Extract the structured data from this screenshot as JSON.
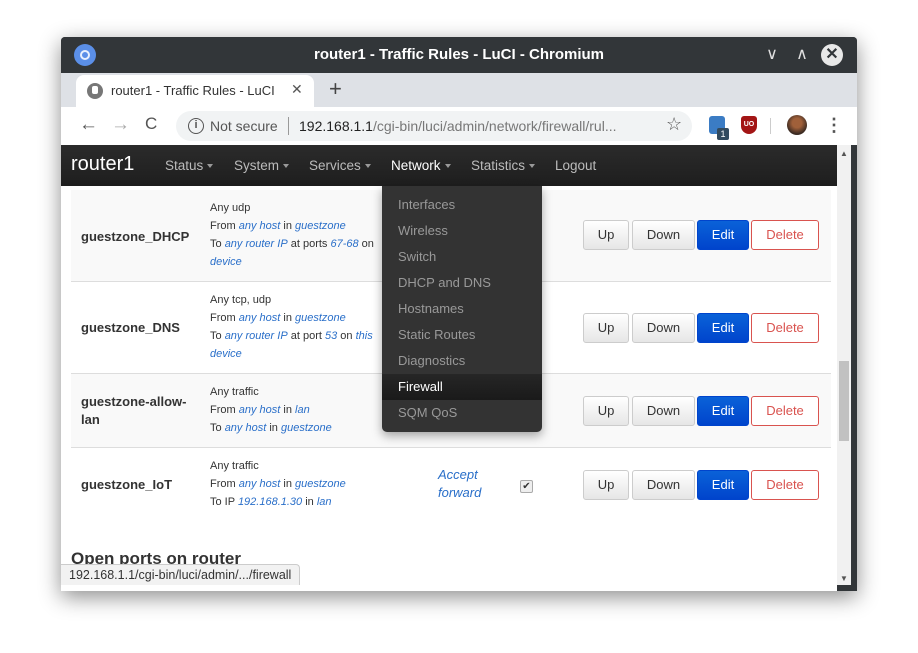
{
  "window": {
    "title": "router1 - Traffic Rules - LuCI - Chromium",
    "controls": {
      "minimize": "∨",
      "maximize": "∧",
      "close": "✕"
    }
  },
  "tab": {
    "title": "router1 - Traffic Rules - LuCI",
    "close": "✕",
    "new_tab": "+"
  },
  "toolbar": {
    "back": "←",
    "forward": "→",
    "reload": "C",
    "security_label": "Not secure",
    "url_host": "192.168.1.1",
    "url_path": "/cgi-bin/luci/admin/network/firewall/rul...",
    "bookmark": "☆",
    "extension_badge": "1",
    "extension2_label": "UO",
    "menu": "⋮"
  },
  "navbar": {
    "brand": "router1",
    "items": [
      {
        "label": "Status",
        "dropdown": true
      },
      {
        "label": "System",
        "dropdown": true
      },
      {
        "label": "Services",
        "dropdown": true
      },
      {
        "label": "Network",
        "dropdown": true
      },
      {
        "label": "Statistics",
        "dropdown": true
      },
      {
        "label": "Logout",
        "dropdown": false
      }
    ]
  },
  "network_menu": {
    "items": [
      "Interfaces",
      "Wireless",
      "Switch",
      "DHCP and DNS",
      "Hostnames",
      "Static Routes",
      "Diagnostics",
      "Firewall",
      "SQM QoS"
    ],
    "active": "Firewall"
  },
  "rules": [
    {
      "name": "guestzone_DHCP",
      "line1": "Any udp",
      "from_pre": "From ",
      "from_host": "any host",
      "from_mid": " in ",
      "from_zone": "guestzone",
      "to_pre": "To ",
      "to_host": "any router IP",
      "to_mid": " at ports ",
      "to_port": "67-68",
      "to_post": " on ",
      "to_device": "device"
    },
    {
      "name": "guestzone_DNS",
      "line1": "Any tcp, udp",
      "from_pre": "From ",
      "from_host": "any host",
      "from_mid": " in ",
      "from_zone": "guestzone",
      "to_pre": "To ",
      "to_host": "any router IP",
      "to_mid": " at port ",
      "to_port": "53",
      "to_post": " on ",
      "to_this": "this",
      "to_device": "device"
    },
    {
      "name": "guestzone-allow-lan",
      "line1": "Any traffic",
      "from_pre": "From ",
      "from_host": "any host",
      "from_mid": " in ",
      "from_zone": "lan",
      "to_pre": "To ",
      "to_host": "any host",
      "to_mid": " in ",
      "to_zone": "guestzone"
    },
    {
      "name": "guestzone_IoT",
      "line1": "Any traffic",
      "from_pre": "From ",
      "from_host": "any host",
      "from_mid": " in ",
      "from_zone": "guestzone",
      "to_pre": "To IP ",
      "to_ip": "192.168.1.30",
      "to_mid": " in ",
      "to_zone": "lan",
      "action": "Accept forward",
      "enabled": true
    }
  ],
  "buttons": {
    "up": "Up",
    "down": "Down",
    "edit": "Edit",
    "delete": "Delete"
  },
  "section_title": "Open ports on router",
  "status_url": "192.168.1.1/cgi-bin/luci/admin/.../firewall",
  "colors": {
    "navbar": "#222222",
    "edit": "#0044cc",
    "delete": "#d9534f",
    "link": "#2a6fc9"
  }
}
